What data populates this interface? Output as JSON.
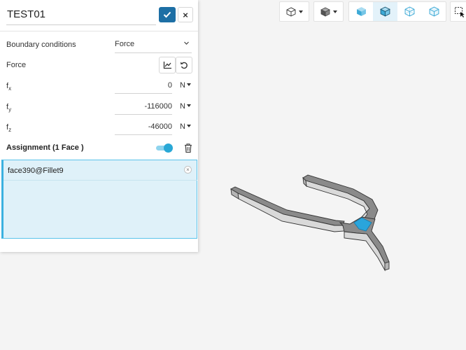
{
  "title": "TEST01",
  "boundary": {
    "label": "Boundary conditions",
    "value": "Force"
  },
  "force": {
    "label": "Force"
  },
  "fields": [
    {
      "name_main": "f",
      "name_sub": "x",
      "value": "0",
      "unit": "N"
    },
    {
      "name_main": "f",
      "name_sub": "y",
      "value": "-116000",
      "unit": "N"
    },
    {
      "name_main": "f",
      "name_sub": "z",
      "value": "-46000",
      "unit": "N"
    }
  ],
  "assignment": {
    "title": "Assignment (1 Face )",
    "items": [
      "face390@Fillet9"
    ],
    "enabled": true
  },
  "toolbar": {
    "icons": [
      "cube-view-icon",
      "cube-shaded-icon",
      "cube-solid-icon",
      "cube-solid-edges-icon",
      "cube-wireframe-icon",
      "cube-transparent-icon",
      "box-select-icon"
    ],
    "active": "cube-solid-edges-icon"
  },
  "colors": {
    "accent": "#1d6fa5",
    "selection": "#dff1f9",
    "toggle": "#29a8d6"
  }
}
